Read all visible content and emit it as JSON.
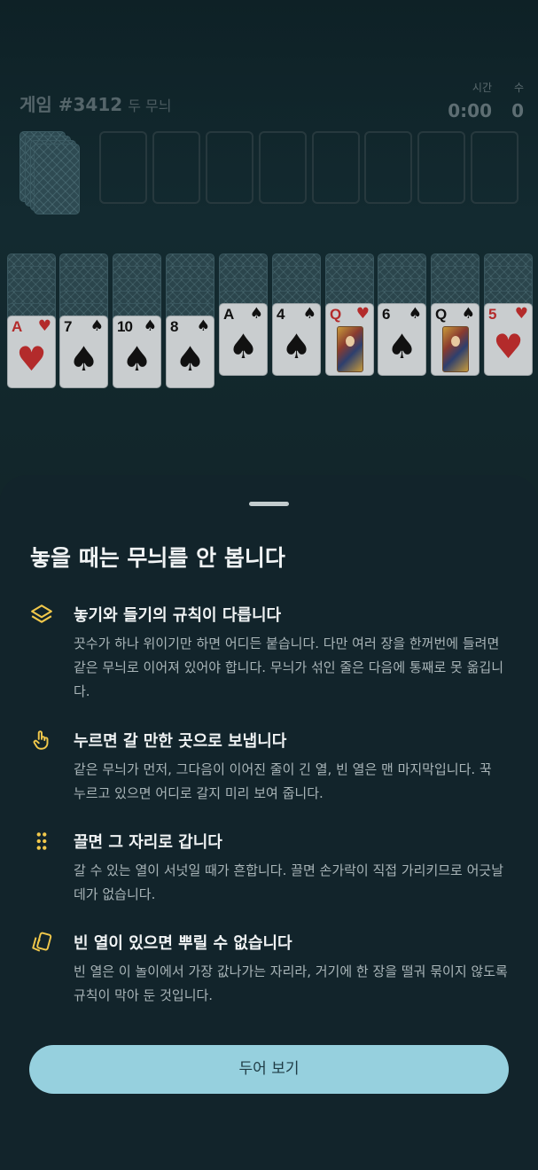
{
  "header": {
    "game_label": "게임 #3412",
    "mode": "두 무늬",
    "time_label": "시간",
    "time_value": "0:00",
    "moves_label": "수",
    "moves_value": "0"
  },
  "tableau": [
    {
      "rank": "A",
      "suit": "♥",
      "color": "red"
    },
    {
      "rank": "7",
      "suit": "♠",
      "color": "black"
    },
    {
      "rank": "10",
      "suit": "♠",
      "color": "black"
    },
    {
      "rank": "8",
      "suit": "♠",
      "color": "black"
    },
    {
      "rank": "A",
      "suit": "♠",
      "color": "black"
    },
    {
      "rank": "4",
      "suit": "♠",
      "color": "black"
    },
    {
      "rank": "Q",
      "suit": "♥",
      "color": "red"
    },
    {
      "rank": "6",
      "suit": "♠",
      "color": "black"
    },
    {
      "rank": "Q",
      "suit": "♠",
      "color": "black"
    },
    {
      "rank": "5",
      "suit": "♥",
      "color": "red"
    }
  ],
  "sheet": {
    "title": "놓을 때는 무늬를 안 봅니다",
    "items": [
      {
        "icon": "layers-icon",
        "heading": "놓기와 들기의 규칙이 다릅니다",
        "body": "끗수가 하나 위이기만 하면 어디든 붙습니다. 다만 여러 장을 한꺼번에 들려면 같은 무늬로 이어져 있어야 합니다. 무늬가 섞인 줄은 다음에 통째로 못 옮깁니다."
      },
      {
        "icon": "tap-icon",
        "heading": "누르면 갈 만한 곳으로 보냅니다",
        "body": "같은 무늬가 먼저, 그다음이 이어진 줄이 긴 열, 빈 열은 맨 마지막입니다. 꾹 누르고 있으면 어디로 갈지 미리 보여 줍니다."
      },
      {
        "icon": "drag-handle-icon",
        "heading": "끌면 그 자리로 갑니다",
        "body": "갈 수 있는 열이 서넛일 때가 흔합니다. 끌면 손가락이 직접 가리키므로 어긋날 데가 없습니다."
      },
      {
        "icon": "cards-icon",
        "heading": "빈 열이 있으면 뿌릴 수 없습니다",
        "body": "빈 열은 이 놀이에서 가장 값나가는 자리라, 거기에 한 장을 떨궈 묶이지 않도록 규칙이 막아 둔 것입니다."
      }
    ],
    "button_label": "두어 보기"
  },
  "colors": {
    "accent": "#96d0de",
    "icon": "#f1c84b",
    "sheet_bg": "#12242b",
    "table_bg": "#0f2027"
  }
}
